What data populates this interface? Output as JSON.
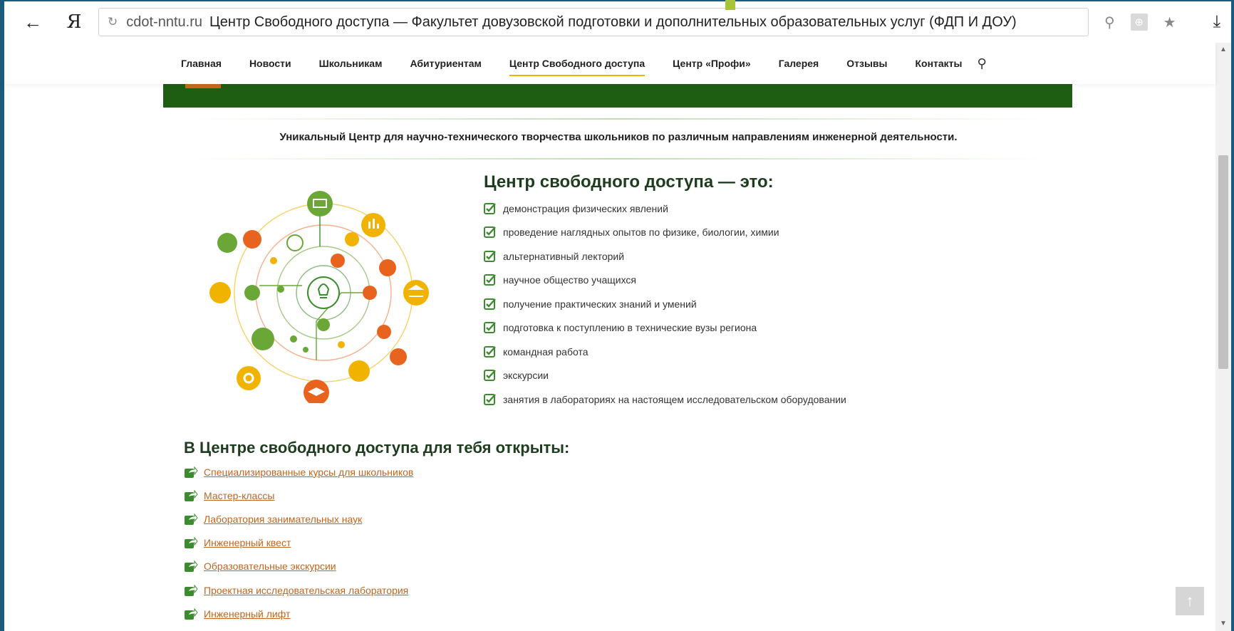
{
  "browser": {
    "back": "←",
    "logo": "Я",
    "reload": "↻",
    "domain": "cdot-nntu.ru",
    "title": "Центр Свободного доступа — Факультет довузовской подготовки и дополнительных образовательных услуг (ФДП И ДОУ)",
    "icons": [
      "search-icon",
      "globe-icon",
      "star-icon",
      "download-icon"
    ]
  },
  "nav": {
    "items": [
      {
        "label": "Главная"
      },
      {
        "label": "Новости"
      },
      {
        "label": "Школьникам"
      },
      {
        "label": "Абитуриентам"
      },
      {
        "label": "Центр Свободного доступа",
        "active": true
      },
      {
        "label": "Центр «Профи»"
      },
      {
        "label": "Галерея"
      },
      {
        "label": "Отзывы"
      },
      {
        "label": "Контакты"
      }
    ],
    "search_icon": "⚲"
  },
  "tagline": "Уникальный Центр для научно-технического творчества школьников по различным направлениям инженерной деятельности.",
  "section1": {
    "title": "Центр свободного доступа — это:",
    "items": [
      "демонстрация физических явлений",
      "проведение наглядных опытов по физике, биологии, химии",
      "альтернативный лекторий",
      "научное общество учащихся",
      "получение практических знаний и умений",
      "подготовка к поступлению в технические вузы региона",
      "командная работа",
      "экскурсии",
      "занятия в лабораториях на настоящем исследовательском оборудовании"
    ]
  },
  "section2": {
    "title": "В Центре свободного доступа для тебя открыты:",
    "links": [
      "Специализированные курсы для школьников",
      "Мастер-классы",
      "Лаборатория занимательных наук",
      "Инженерный квест",
      "Образовательные экскурсии",
      "Проектная исследовательская лаборатория",
      "Инженерный лифт"
    ]
  },
  "colors": {
    "accent_green": "#1e5e13",
    "link_orange": "#c2651e",
    "check_green": "#3d8b2f",
    "nav_underline": "#f0b400"
  },
  "to_top": "↑"
}
